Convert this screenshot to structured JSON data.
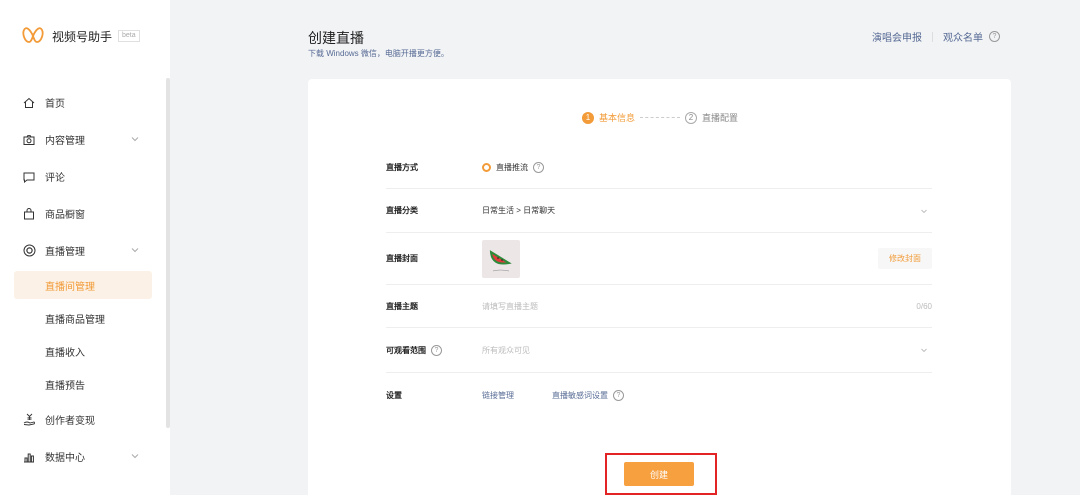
{
  "app": {
    "name": "视频号助手",
    "badge": "beta"
  },
  "sidebar": {
    "items": [
      {
        "label": "首页",
        "icon": "home-icon"
      },
      {
        "label": "内容管理",
        "icon": "camera-icon",
        "expandable": true
      },
      {
        "label": "评论",
        "icon": "comment-icon"
      },
      {
        "label": "商品橱窗",
        "icon": "shopping-bag-icon"
      },
      {
        "label": "直播管理",
        "icon": "live-icon",
        "expandable": true,
        "expanded": true
      }
    ],
    "live_subitems": [
      {
        "label": "直播间管理",
        "active": true
      },
      {
        "label": "直播商品管理"
      },
      {
        "label": "直播收入"
      },
      {
        "label": "直播预告"
      }
    ],
    "bottom_items": [
      {
        "label": "创作者变现",
        "icon": "money-hand-icon"
      },
      {
        "label": "数据中心",
        "icon": "bar-chart-icon",
        "expandable": true
      }
    ]
  },
  "header": {
    "title": "创建直播",
    "subtitle": "下载 Windows 微信，电脑开播更方便。",
    "link_concert": "演唱会申报",
    "link_audience": "观众名单"
  },
  "steps": [
    {
      "num": "1",
      "label": "基本信息",
      "active": true
    },
    {
      "num": "2",
      "label": "直播配置",
      "active": false
    }
  ],
  "form": {
    "mode_label": "直播方式",
    "mode_value": "直播推流",
    "category_label": "直播分类",
    "category_value": "日常生活 > 日常聊天",
    "cover_label": "直播封面",
    "cover_button": "修改封面",
    "topic_label": "直播主题",
    "topic_placeholder": "请填写直播主题",
    "topic_counter": "0/60",
    "visibility_label": "可观看范围",
    "visibility_value": "所有观众可见",
    "settings_label": "设置",
    "settings_link1": "链接管理",
    "settings_link2": "直播敏感词设置"
  },
  "create_button": "创建",
  "colors": {
    "accent": "#f29b38",
    "link": "#576b95",
    "highlight": "#e32424"
  }
}
